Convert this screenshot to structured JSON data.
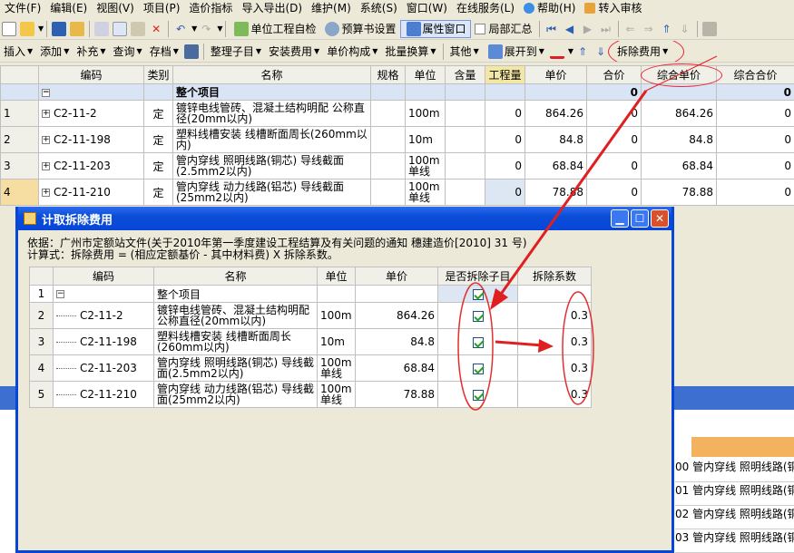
{
  "menubar": [
    "文件(F)",
    "编辑(E)",
    "视图(V)",
    "项目(P)",
    "造价指标",
    "导入导出(D)",
    "维护(M)",
    "系统(S)",
    "窗口(W)",
    "在线服务(L)",
    "帮助(H)",
    "转入审核"
  ],
  "toolbar1": {
    "check_label": "单位工程自检",
    "budget_label": "预算书设置",
    "attr_label": "属性窗口",
    "local_summary": "局部汇总"
  },
  "toolbar2": {
    "items": [
      "插入",
      "添加",
      "补充",
      "查询",
      "存档",
      "整理子目",
      "安装费用",
      "单价构成",
      "批量换算",
      "其他",
      "展开到",
      "拆除费用"
    ]
  },
  "grid": {
    "headers": [
      "编码",
      "类别",
      "名称",
      "规格",
      "单位",
      "含量",
      "工程量",
      "单价",
      "合价",
      "综合单价",
      "综合合价"
    ],
    "total": {
      "name": "整个项目",
      "合价": "0",
      "综合合价": "0"
    },
    "rows": [
      {
        "no": "1",
        "code": "C2-11-2",
        "type": "定",
        "name": "镀锌电线管砖、混凝土结构明配 公称直径(20mm以内)",
        "unit": "100m",
        "qty": "0",
        "price": "864.26",
        "total": "0",
        "uprice": "864.26",
        "utotal": "0"
      },
      {
        "no": "2",
        "code": "C2-11-198",
        "type": "定",
        "name": "塑料线槽安装 线槽断面周长(260mm以内)",
        "unit": "10m",
        "qty": "0",
        "price": "84.8",
        "total": "0",
        "uprice": "84.8",
        "utotal": "0"
      },
      {
        "no": "3",
        "code": "C2-11-203",
        "type": "定",
        "name": "管内穿线 照明线路(铜芯) 导线截面(2.5mm2以内)",
        "unit": "100m单线",
        "qty": "0",
        "price": "68.84",
        "total": "0",
        "uprice": "68.84",
        "utotal": "0"
      },
      {
        "no": "4",
        "code": "C2-11-210",
        "type": "定",
        "name": "管内穿线 动力线路(铝芯) 导线截面(25mm2以内)",
        "unit": "100m单线",
        "qty": "0",
        "price": "78.88",
        "total": "0",
        "uprice": "78.88",
        "utotal": "0"
      }
    ]
  },
  "bg_right": {
    "rows": [
      {
        "c": "00",
        "t": "管内穿线 照明线路(铜"
      },
      {
        "c": "01",
        "t": "管内穿线 照明线路(铜"
      },
      {
        "c": "02",
        "t": "管内穿线 照明线路(铜"
      },
      {
        "c": "03",
        "t": "管内穿线 照明线路(铜"
      }
    ]
  },
  "dialog": {
    "title": "计取拆除费用",
    "basis": "依据：广州市定额站文件(关于2010年第一季度建设工程结算及有关问题的通知 穗建造价[2010] 31 号)",
    "formula": "计算式：拆除费用 = (相应定额基价 - 其中材料费) X 拆除系数。",
    "headers": [
      "编码",
      "名称",
      "单位",
      "单价",
      "是否拆除子目",
      "拆除系数"
    ],
    "total_name": "整个项目",
    "rows": [
      {
        "no": "2",
        "code": "C2-11-2",
        "name": "镀锌电线管砖、混凝土结构明配公称直径(20mm以内)",
        "unit": "100m",
        "price": "864.26",
        "coef": "0.3"
      },
      {
        "no": "3",
        "code": "C2-11-198",
        "name": "塑料线槽安装 线槽断面周长(260mm以内)",
        "unit": "10m",
        "price": "84.8",
        "coef": "0.3"
      },
      {
        "no": "4",
        "code": "C2-11-203",
        "name": "管内穿线 照明线路(铜芯) 导线截面(2.5mm2以内)",
        "unit": "100m单线",
        "price": "68.84",
        "coef": "0.3"
      },
      {
        "no": "5",
        "code": "C2-11-210",
        "name": "管内穿线 动力线路(铝芯) 导线截面(25mm2以内)",
        "unit": "100m单线",
        "price": "78.88",
        "coef": "0.3"
      }
    ]
  },
  "colors": {
    "titlebar": "#0846d8",
    "callout": "#e23030",
    "highlight": "#f3e7a5"
  }
}
